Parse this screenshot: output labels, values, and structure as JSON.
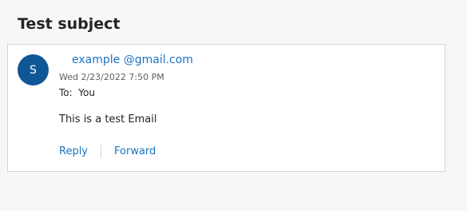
{
  "message": {
    "subject": "Test subject",
    "avatar_initial": "S",
    "sender_name_hidden": " ",
    "sender_address": "example @gmail.com",
    "date": "Wed 2/23/2022 7:50 PM",
    "to_line": "To:  You",
    "body": "This is a test Email"
  },
  "actions": {
    "reply_label": "Reply",
    "forward_label": "Forward"
  },
  "colors": {
    "accent": "#1a73c0",
    "avatar_bg": "#0f5697",
    "page_bg": "#f8f7f5"
  }
}
